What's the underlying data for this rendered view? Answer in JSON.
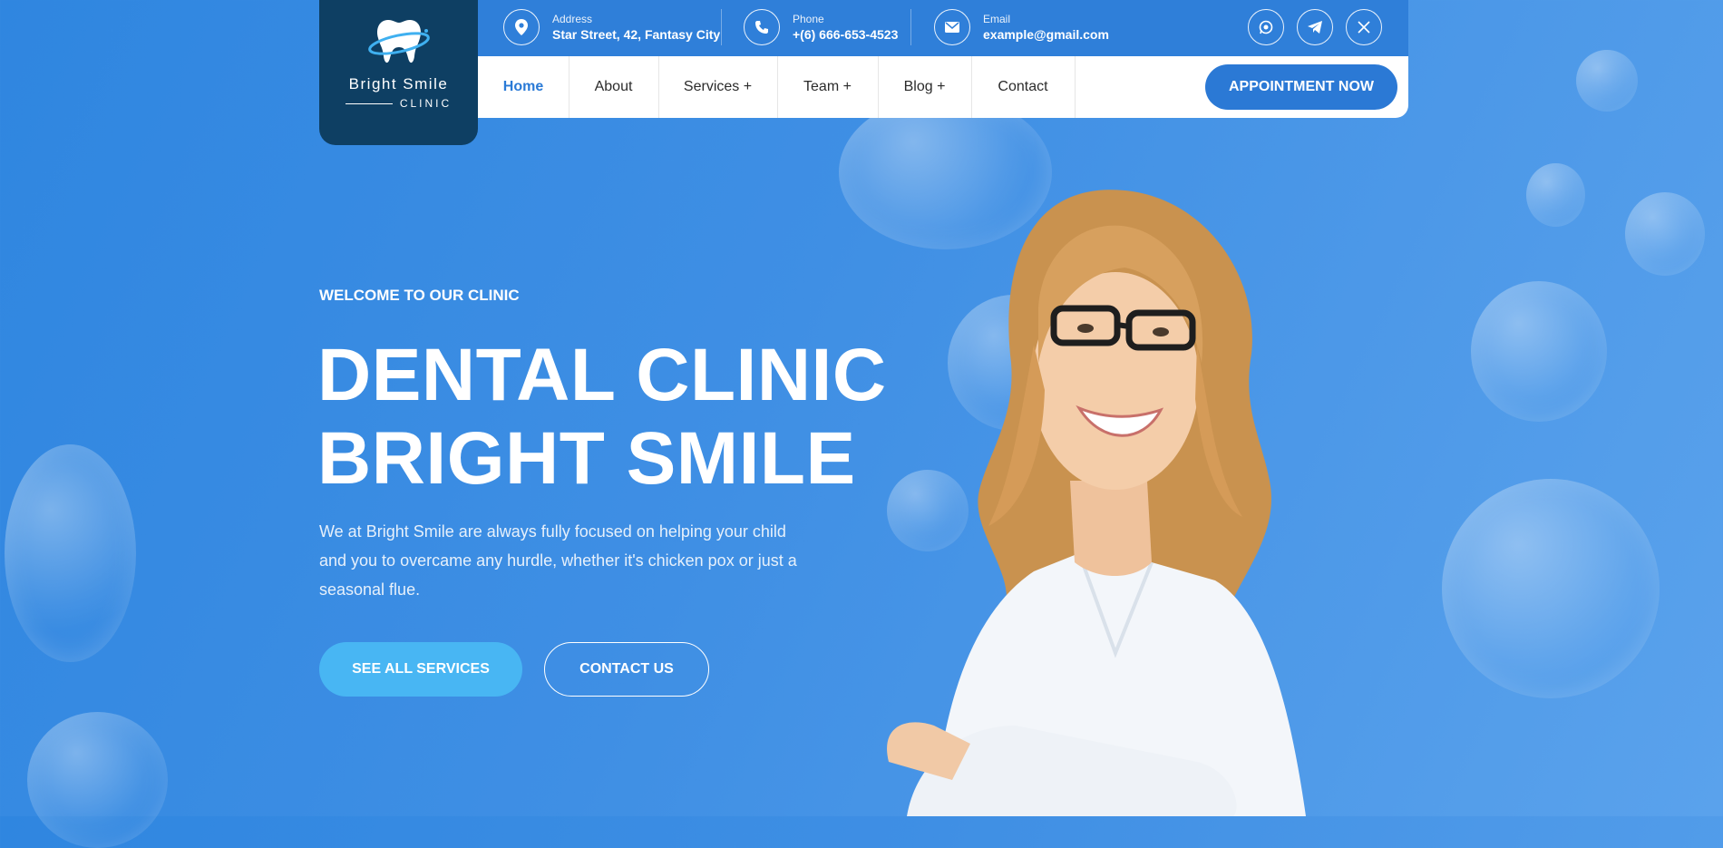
{
  "logo": {
    "name": "Bright  Smile",
    "sub": "CLINIC"
  },
  "topbar": {
    "address": {
      "label": "Address",
      "value": "Star Street, 42, Fantasy City"
    },
    "phone": {
      "label": "Phone",
      "value": "+(6) 666-653-4523"
    },
    "email": {
      "label": "Email",
      "value": "example@gmail.com"
    },
    "social": [
      "whatsapp-icon",
      "telegram-icon",
      "x-icon"
    ]
  },
  "nav": {
    "items": [
      {
        "label": "Home"
      },
      {
        "label": "About"
      },
      {
        "label": "Services +"
      },
      {
        "label": "Team +"
      },
      {
        "label": "Blog +"
      },
      {
        "label": "Contact"
      }
    ],
    "cta": "APPOINTMENT NOW"
  },
  "hero": {
    "welcome": "WELCOME TO OUR CLINIC",
    "headline_line1": "DENTAL CLINIC",
    "headline_line2": "BRIGHT SMILE",
    "description": "We at Bright Smile are always fully focused on helping your child and you to overcame any hurdle, whether it's chicken pox or just a seasonal flue.",
    "primary_button": "SEE ALL SERVICES",
    "secondary_button": "CONTACT US"
  },
  "colors": {
    "background": "#3f8fe4",
    "logo_bg": "#0e3f63",
    "accent": "#2b79d5",
    "button_light": "#48b6f3"
  }
}
